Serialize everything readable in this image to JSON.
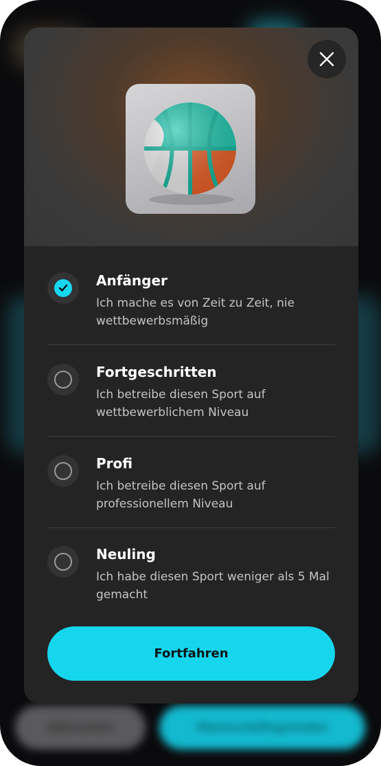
{
  "background": {
    "left_button_label": "Abbrechen",
    "right_button_label": "Mannschaftsgründen"
  },
  "modal": {
    "close_icon": "close-icon",
    "hero_image": "basketball-image",
    "options": [
      {
        "title": "Anfänger",
        "description": "Ich mache es von Zeit zu Zeit, nie wettbewerbsmäßig",
        "selected": true
      },
      {
        "title": "Fortgeschritten",
        "description": "Ich betreibe diesen Sport auf wettbewerblichem Niveau",
        "selected": false
      },
      {
        "title": "Profi",
        "description": "Ich betreibe diesen Sport auf professionellem Niveau",
        "selected": false
      },
      {
        "title": "Neuling",
        "description": "Ich habe diesen Sport weniger als 5 Mal gemacht",
        "selected": false
      }
    ],
    "continue_label": "Fortfahren"
  },
  "colors": {
    "accent": "#16d6ee",
    "modal_bg": "#242424",
    "hero_glow": "#7a4a26"
  }
}
